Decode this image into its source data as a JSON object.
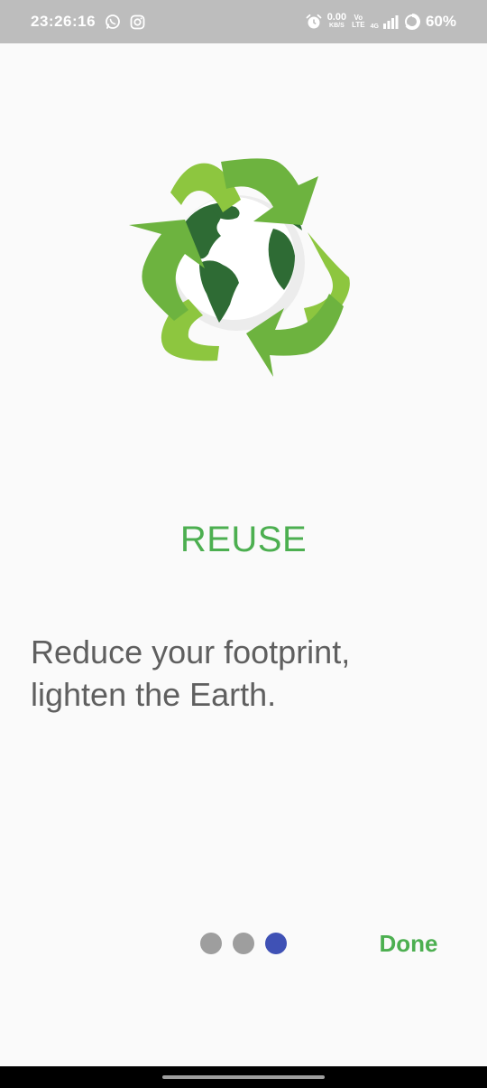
{
  "status_bar": {
    "time": "23:26:16",
    "net_speed_value": "0.00",
    "net_speed_unit": "KB/S",
    "volte_top": "Vo",
    "volte_bottom": "LTE",
    "network_type": "4G",
    "battery": "60%"
  },
  "onboarding": {
    "title": "REUSE",
    "description": "Reduce your footprint, lighten the Earth.",
    "page_count": 3,
    "current_page": 3,
    "done_label": "Done"
  },
  "colors": {
    "accent_green": "#4caf50",
    "active_dot": "#3f51b5",
    "inactive_dot": "#9e9e9e"
  },
  "icons": [
    "whatsapp-icon",
    "instagram-icon",
    "alarm-icon",
    "signal-icon",
    "battery-icon",
    "recycle-globe-logo"
  ]
}
